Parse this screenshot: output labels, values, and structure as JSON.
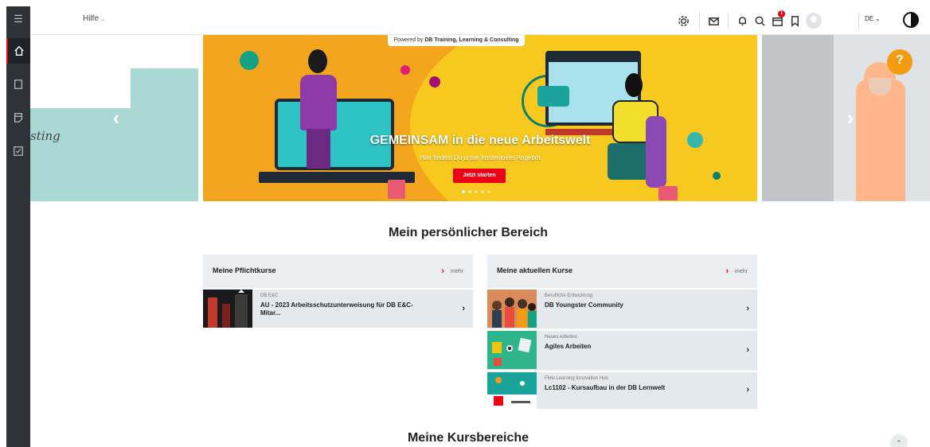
{
  "topbar": {
    "help_label": "Hilfe",
    "notifications_count": "1",
    "language": "DE"
  },
  "hero": {
    "powered_prefix": "Powered by ",
    "powered_brand": "DB Training, Learning & Consulting",
    "left_slide_text": "sting",
    "title": "GEMEINSAM in die neue Arbeitswelt",
    "subtitle": "Hier findest Du unser kostenloses Angebot",
    "cta_label": "Jetzt starten",
    "help_badge": "?",
    "active_slide": 1,
    "slide_count": 5
  },
  "personal": {
    "title": "Mein persönlicher Bereich"
  },
  "required_courses": {
    "title": "Meine Pflichtkurse",
    "more_label": "mehr",
    "items": [
      {
        "category": "DB E&C",
        "name": "AU - 2023 Arbeitsschutzunterweisung für DB E&C-Mitar..."
      }
    ]
  },
  "current_courses": {
    "title": "Meine aktuellen Kurse",
    "more_label": "mehr",
    "items": [
      {
        "category": "Berufliche Entwicklung",
        "name": "DB Youngster Community"
      },
      {
        "category": "Neues Arbeiten",
        "name": "Agiles Arbeiten"
      },
      {
        "category": "Flow Learning Innovation Hub",
        "name": "Lc1102 - Kursaufbau in der DB Lernwelt"
      }
    ]
  },
  "course_areas": {
    "title": "Meine Kursbereiche"
  },
  "colors": {
    "accent": "#ec0016",
    "sidebar": "#2f3338",
    "panel": "#eaeef1"
  }
}
